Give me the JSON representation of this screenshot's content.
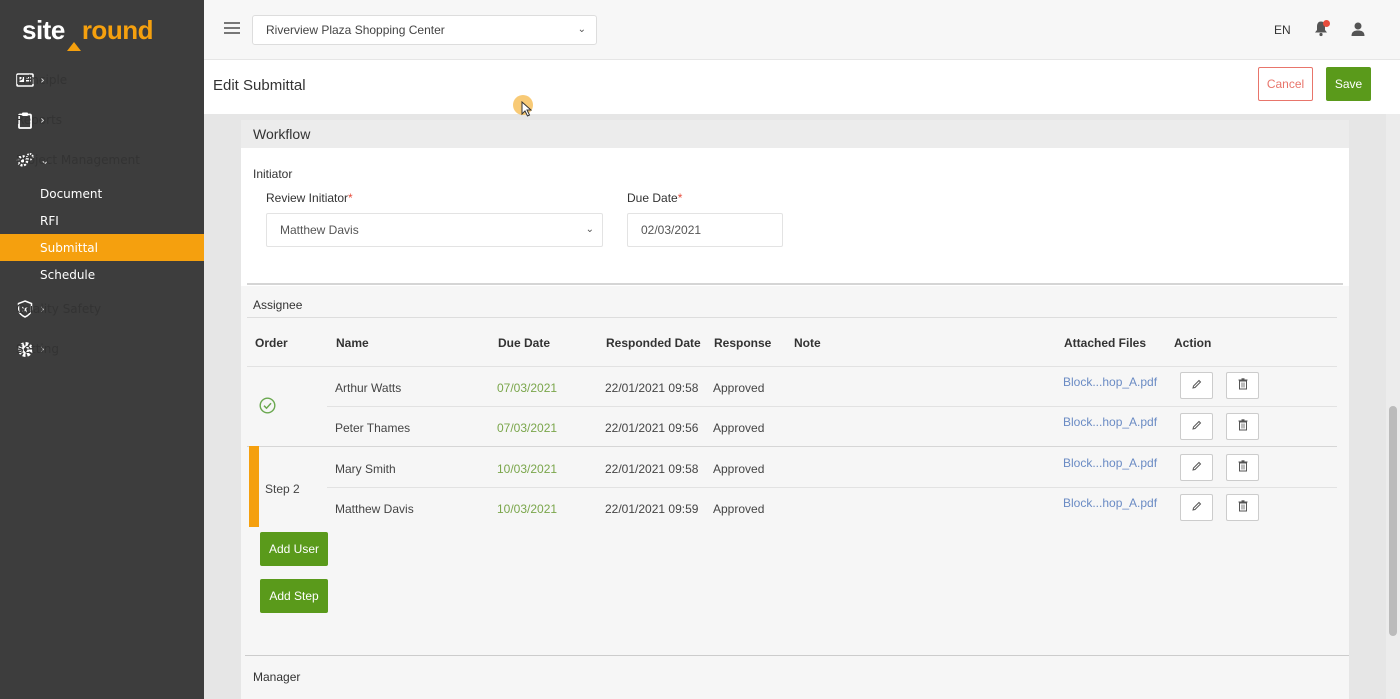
{
  "brand": {
    "part1": "site",
    "part2": "round"
  },
  "sidebar": {
    "items": [
      {
        "label": "Principle",
        "icon": "id-card-icon"
      },
      {
        "label": "Reports",
        "icon": "clipboard-icon"
      },
      {
        "label": "Project Management",
        "icon": "gears-icon"
      },
      {
        "label": "Quality Safety",
        "icon": "shield-icon"
      },
      {
        "label": "Setting",
        "icon": "gear-icon"
      }
    ],
    "sub_items": [
      "Document",
      "RFI",
      "Submittal",
      "Schedule"
    ],
    "active_sub": "Submittal"
  },
  "topbar": {
    "project": "Riverview Plaza Shopping Center",
    "language": "EN"
  },
  "header": {
    "title": "Edit Submittal",
    "cancel_label": "Cancel",
    "save_label": "Save"
  },
  "workflow": {
    "title": "Workflow",
    "initiator_title": "Initiator",
    "review_initiator_label": "Review Initiator",
    "review_initiator_value": "Matthew Davis",
    "due_date_label": "Due Date",
    "due_date_value": "02/03/2021",
    "required_mark": "*"
  },
  "assignee": {
    "title": "Assignee",
    "columns": [
      "Order",
      "Name",
      "Due Date",
      "Responded Date",
      "Response",
      "Note",
      "Attached Files",
      "Action"
    ],
    "rows": [
      {
        "name": "Arthur Watts",
        "due": "07/03/2021",
        "responded": "22/01/2021 09:58",
        "response": "Approved",
        "note": "",
        "file": "Block...hop_A.pdf"
      },
      {
        "name": "Peter Thames",
        "due": "07/03/2021",
        "responded": "22/01/2021 09:56",
        "response": "Approved",
        "note": "",
        "file": "Block...hop_A.pdf"
      },
      {
        "name": "Mary Smith",
        "due": "10/03/2021",
        "responded": "22/01/2021 09:58",
        "response": "Approved",
        "note": "",
        "file": "Block...hop_A.pdf"
      },
      {
        "name": "Matthew Davis",
        "due": "10/03/2021",
        "responded": "22/01/2021 09:59",
        "response": "Approved",
        "note": "",
        "file": "Block...hop_A.pdf"
      }
    ],
    "step2_label": "Step 2",
    "add_user_label": "Add User",
    "add_step_label": "Add Step"
  },
  "manager": {
    "title": "Manager"
  },
  "colors": {
    "accent": "#f5a00e",
    "save_green": "#5a9a1b",
    "cancel_red": "#e8756b",
    "sidebar_bg": "#3d3d3d"
  }
}
